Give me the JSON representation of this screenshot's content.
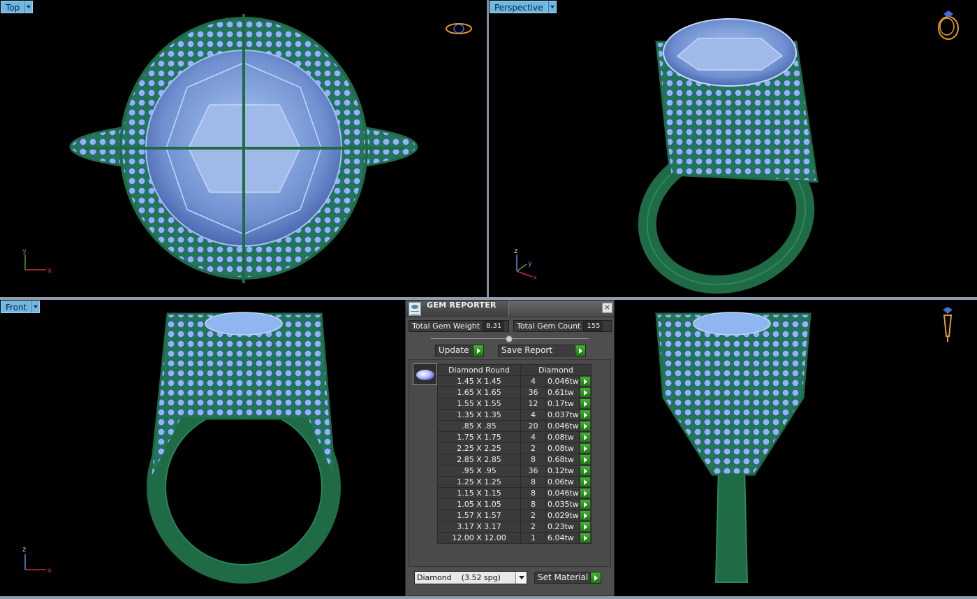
{
  "viewports": {
    "top": {
      "label": "Top",
      "axis": {
        "h": "x",
        "v": "y"
      }
    },
    "perspective": {
      "label": "Perspective",
      "axis": {
        "h": "x",
        "v": "y",
        "up": "z"
      }
    },
    "front": {
      "label": "Front",
      "axis": {
        "h": "x",
        "v": "z"
      }
    }
  },
  "icons": {
    "viewport_dropdown": "chevron-down-icon",
    "axis_gizmo": "axis-gizmo-icon",
    "ring_preview": "ring-preview-icon",
    "gem_reporter_app": "gem-reporter-icon",
    "close": "close-icon",
    "go_arrow": "play-arrow-icon",
    "gem_thumbnail": "round-diamond-icon"
  },
  "colors": {
    "viewport_label_bg": "#6fb6e2",
    "metal": "#1e6b46",
    "gem": "#8fb6f0",
    "accent_green": "#2e9a22"
  },
  "gem_reporter": {
    "title": "GEM REPORTER",
    "total_gem_weight_label": "Total Gem Weight",
    "total_gem_weight": "8.31",
    "total_gem_count_label": "Total Gem Count",
    "total_gem_count": "155",
    "update_label": "Update",
    "save_report_label": "Save Report",
    "columns": {
      "shape": "Diamond Round",
      "material": "Diamond"
    },
    "rows": [
      {
        "size": "1.45 X 1.45",
        "qty": "4",
        "weight": "0.046tw"
      },
      {
        "size": "1.65 X 1.65",
        "qty": "36",
        "weight": "0.61tw"
      },
      {
        "size": "1.55 X 1.55",
        "qty": "12",
        "weight": "0.17tw"
      },
      {
        "size": "1.35 X 1.35",
        "qty": "4",
        "weight": "0.037tw"
      },
      {
        "size": ".85 X .85",
        "qty": "20",
        "weight": "0.046tw"
      },
      {
        "size": "1.75 X 1.75",
        "qty": "4",
        "weight": "0.08tw"
      },
      {
        "size": "2.25 X 2.25",
        "qty": "2",
        "weight": "0.08tw"
      },
      {
        "size": "2.85 X 2.85",
        "qty": "8",
        "weight": "0.68tw"
      },
      {
        "size": ".95 X .95",
        "qty": "36",
        "weight": "0.12tw"
      },
      {
        "size": "1.25 X 1.25",
        "qty": "8",
        "weight": "0.06tw"
      },
      {
        "size": "1.15 X 1.15",
        "qty": "8",
        "weight": "0.046tw"
      },
      {
        "size": "1.05 X 1.05",
        "qty": "8",
        "weight": "0.035tw"
      },
      {
        "size": "1.57 X 1.57",
        "qty": "2",
        "weight": "0.029tw"
      },
      {
        "size": "3.17 X 3.17",
        "qty": "2",
        "weight": "0.23tw"
      },
      {
        "size": "12.00 X 12.00",
        "qty": "1",
        "weight": "6.04tw"
      }
    ],
    "material_select": "Diamond    (3.52 spg)",
    "set_material_label": "Set Material"
  }
}
